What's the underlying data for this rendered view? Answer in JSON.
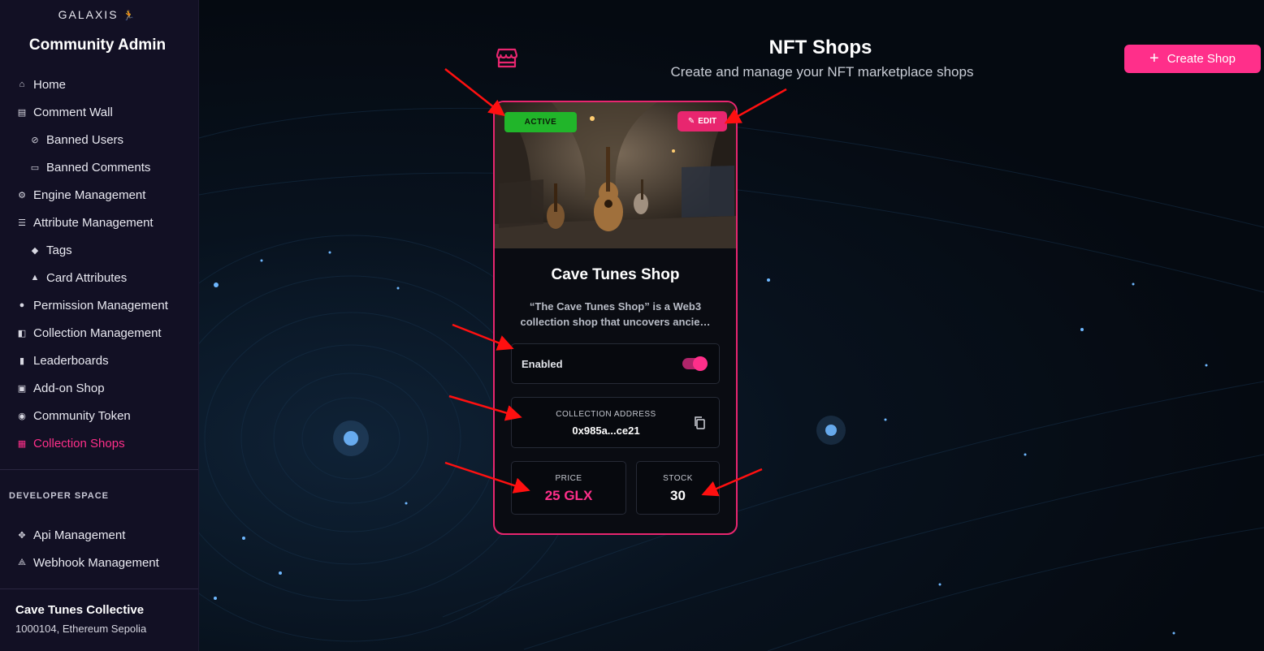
{
  "sidebar": {
    "logo": "GALAXIS",
    "title": "Community Admin",
    "items": [
      {
        "label": "Home",
        "icon": "home-icon"
      },
      {
        "label": "Comment Wall",
        "icon": "comment-icon"
      },
      {
        "label": "Banned Users",
        "icon": "banned-user-icon"
      },
      {
        "label": "Banned Comments",
        "icon": "banned-comment-icon"
      },
      {
        "label": "Engine Management",
        "icon": "gear-icon"
      },
      {
        "label": "Attribute Management",
        "icon": "sliders-icon"
      },
      {
        "label": "Tags",
        "icon": "tag-icon"
      },
      {
        "label": "Card Attributes",
        "icon": "card-attribute-icon"
      },
      {
        "label": "Permission Management",
        "icon": "permission-icon"
      },
      {
        "label": "Collection Management",
        "icon": "collection-icon"
      },
      {
        "label": "Leaderboards",
        "icon": "bar-chart-icon"
      },
      {
        "label": "Add-on Shop",
        "icon": "addon-shop-icon"
      },
      {
        "label": "Community Token",
        "icon": "token-icon"
      },
      {
        "label": "Collection Shops",
        "icon": "store-icon"
      }
    ],
    "developer_title": "DEVELOPER SPACE",
    "developer_items": [
      {
        "label": "Api Management",
        "icon": "api-icon"
      },
      {
        "label": "Webhook Management",
        "icon": "webhook-icon"
      }
    ],
    "community_name": "Cave Tunes Collective",
    "community_meta": "1000104, Ethereum Sepolia"
  },
  "header": {
    "title": "NFT Shops",
    "subtitle": "Create and manage your NFT marketplace shops",
    "create_label": "Create Shop"
  },
  "shop": {
    "status": "ACTIVE",
    "edit_label": "EDIT",
    "name": "Cave Tunes Shop",
    "description_line1": "“The Cave Tunes Shop” is a Web3",
    "description_line2": "collection shop that uncovers ancie…",
    "enabled_label": "Enabled",
    "enabled": true,
    "address_label": "COLLECTION ADDRESS",
    "address": "0x985a...ce21",
    "price_label": "PRICE",
    "price": "25 GLX",
    "stock_label": "STOCK",
    "stock": "30"
  },
  "colors": {
    "accent": "#ff2f8a",
    "active_badge": "#21b52a",
    "sidebar_bg": "#121024",
    "annotation_arrow": "#ff1010"
  }
}
